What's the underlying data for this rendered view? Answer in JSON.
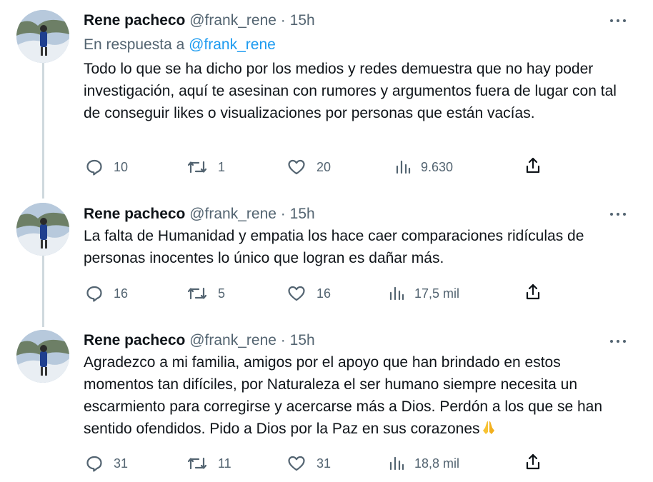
{
  "tweets": [
    {
      "name": "Rene pacheco",
      "handle": "@frank_rene",
      "time": "15h",
      "reply_prefix": "En respuesta a",
      "reply_to": "@frank_rene",
      "text": "Todo lo que se ha dicho por los medios y redes demuestra que no hay poder investigación, aquí te asesinan con rumores y argumentos fuera de lugar con tal de conseguir likes o visualizaciones por personas que están vacías.",
      "replies": "10",
      "retweets": "1",
      "likes": "20",
      "views": "9.630"
    },
    {
      "name": "Rene pacheco",
      "handle": "@frank_rene",
      "time": "15h",
      "text": "La falta de Humanidad y empatia los hace caer comparaciones ridículas de personas inocentes lo único que logran es dañar más.",
      "replies": "16",
      "retweets": "5",
      "likes": "16",
      "views": "17,5 mil"
    },
    {
      "name": "Rene pacheco",
      "handle": "@frank_rene",
      "time": "15h",
      "text": "Agradezco a mi familia, amigos por el apoyo que han brindado en estos momentos tan difíciles,  por Naturaleza el ser humano siempre necesita un escarmiento para corregirse y acercarse más a Dios. Perdón a los que se han sentido ofendidos. Pido a Dios por la Paz en sus corazones",
      "emoji": "folded-hands-icon",
      "replies": "31",
      "retweets": "11",
      "likes": "31",
      "views": "18,8 mil"
    }
  ],
  "separator": "·",
  "colors": {
    "text": "#0f1419",
    "muted": "#536471",
    "link": "#1d9bf0",
    "thread_line": "#cfd9de"
  }
}
